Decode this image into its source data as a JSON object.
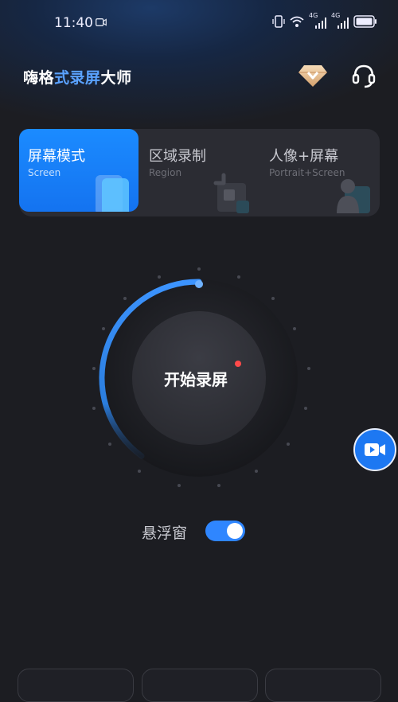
{
  "status_bar": {
    "time": "11:40",
    "network_1": "4G",
    "network_2": "4G"
  },
  "header": {
    "title_part1": "嗨格",
    "title_part2": "式录屏",
    "title_part3": "大师",
    "premium_icon": "diamond-icon",
    "support_icon": "headset-icon"
  },
  "modes": [
    {
      "title": "屏幕模式",
      "subtitle": "Screen",
      "active": true
    },
    {
      "title": "区域录制",
      "subtitle": "Region",
      "active": false
    },
    {
      "title": "人像+屏幕",
      "subtitle": "Portrait+Screen",
      "active": false
    }
  ],
  "record": {
    "label": "开始录屏"
  },
  "floating_window": {
    "label": "悬浮窗",
    "enabled": true
  },
  "colors": {
    "accent": "#1d78f2",
    "background": "#1c1d22",
    "panel": "#2b2c33"
  }
}
